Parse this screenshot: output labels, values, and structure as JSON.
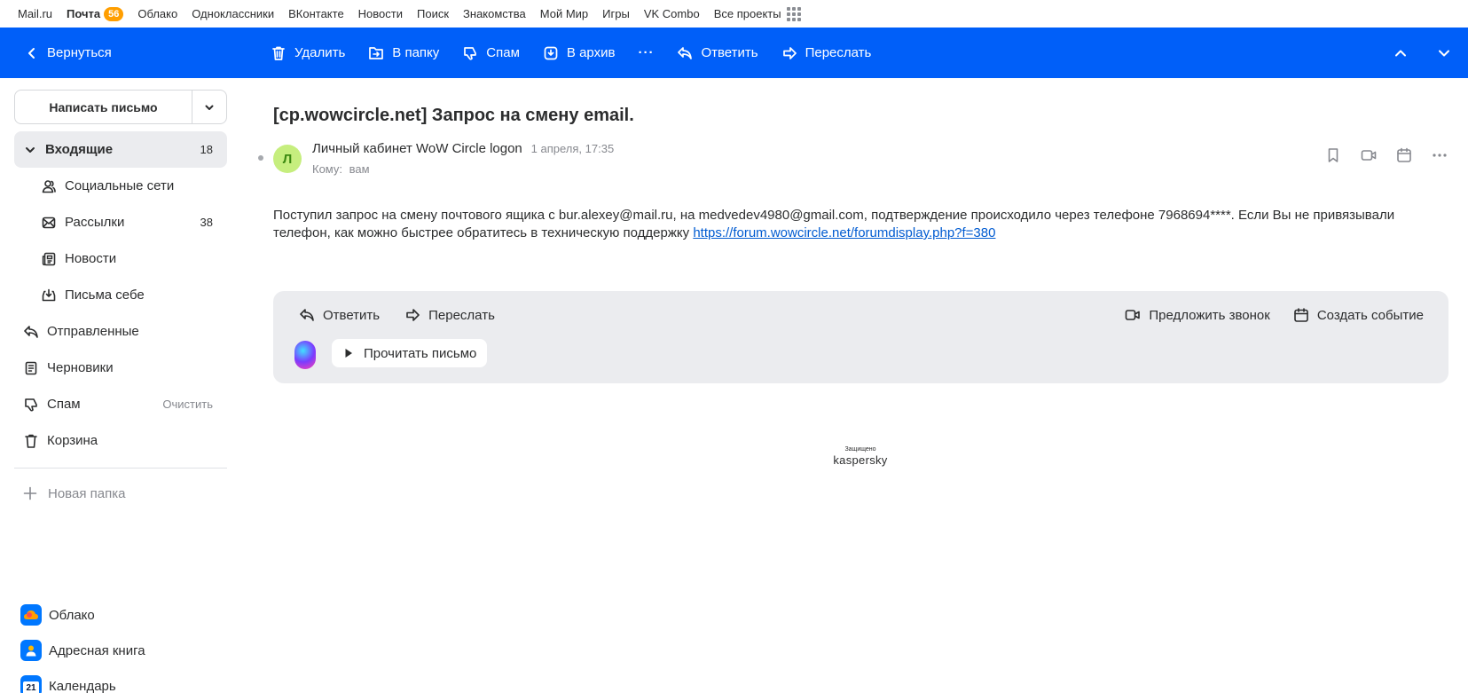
{
  "portal": {
    "links": [
      "Mail.ru",
      "Почта",
      "Облако",
      "Одноклассники",
      "ВКонтакте",
      "Новости",
      "Поиск",
      "Знакомства",
      "Мой Мир",
      "Игры",
      "VK Combo",
      "Все проекты"
    ],
    "mail_badge": "56"
  },
  "toolbar": {
    "back": "Вернуться",
    "delete": "Удалить",
    "to_folder": "В папку",
    "spam": "Спам",
    "archive": "В архив",
    "more": "···",
    "reply": "Ответить",
    "forward": "Переслать"
  },
  "sidebar": {
    "compose": "Написать письмо",
    "folders": [
      {
        "label": "Входящие",
        "count": "18"
      },
      {
        "label": "Социальные сети",
        "count": ""
      },
      {
        "label": "Рассылки",
        "count": "38"
      },
      {
        "label": "Новости",
        "count": ""
      },
      {
        "label": "Письма себе",
        "count": ""
      },
      {
        "label": "Отправленные",
        "count": ""
      },
      {
        "label": "Черновики",
        "count": ""
      },
      {
        "label": "Спам",
        "count": "",
        "action": "Очистить"
      },
      {
        "label": "Корзина",
        "count": ""
      }
    ],
    "new_folder": "Новая папка",
    "apps": [
      {
        "label": "Облако",
        "color": "#0077ff"
      },
      {
        "label": "Адресная книга",
        "color": "#0077ff"
      },
      {
        "label": "Календарь",
        "color": "#0077ff",
        "day": "21"
      }
    ]
  },
  "message": {
    "subject": "[cp.wowcircle.net] Запрос на смену email.",
    "avatar_letter": "Л",
    "sender": "Личный кабинет WoW Circle logon",
    "date": "1 апреля, 17:35",
    "to_label": "Кому:",
    "to_value": "вам",
    "body_text": "Поступил запрос на смену почтового ящика с bur.alexey@mail.ru, на medvedev4980@gmail.com, подтверждение происходило через телефоне 7968694****. Если Вы не привязывали телефон, как можно быстрее обратитесь в техническую поддержку ",
    "body_link": "https://forum.wowcircle.net/forumdisplay.php?f=380"
  },
  "panel": {
    "reply": "Ответить",
    "forward": "Переслать",
    "propose_call": "Предложить звонок",
    "create_event": "Создать событие",
    "read_aloud": "Прочитать письмо"
  },
  "footer": {
    "protected": "Защищено",
    "brand": "kaspersky"
  },
  "colors": {
    "accent": "#005ff9",
    "badge": "#ff9e00",
    "avatar_bg": "#c6ee7e",
    "link": "#005bd1"
  }
}
